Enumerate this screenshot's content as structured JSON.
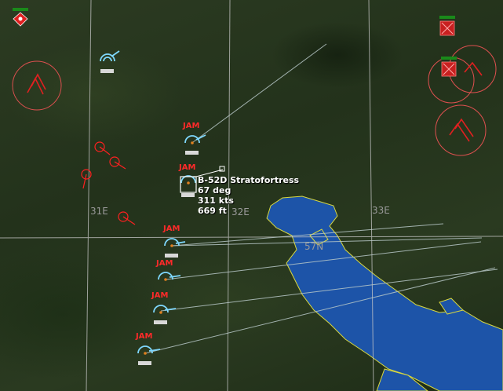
{
  "grid_labels": [
    "31E",
    "32E",
    "33E",
    "57N"
  ],
  "selected_unit": {
    "name": "B-52D Stratofortress",
    "heading": "67 deg",
    "speed": "311 kts",
    "altitude": "669 ft"
  },
  "jam_label": "JAM",
  "colors": {
    "friendly": "#7fd8ff",
    "hostile": "#ff3030",
    "water": "#1d54a8",
    "coast": "#d8d840",
    "grid": "#c8c8c8"
  }
}
